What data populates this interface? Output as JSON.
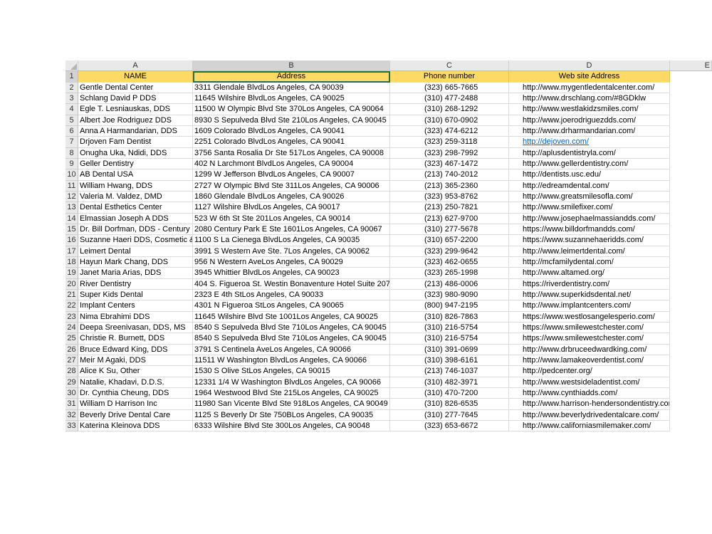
{
  "columns": [
    "A",
    "B",
    "C",
    "D",
    "E"
  ],
  "header_row": {
    "num": "1",
    "name": "NAME",
    "address": "Address",
    "phone": "Phone number",
    "website": "Web site Address"
  },
  "rows": [
    {
      "num": "2",
      "name": "Gentle Dental Center",
      "address": "3311 Glendale BlvdLos Angeles, CA 90039",
      "phone": "(323) 665-7665",
      "website": "http://www.mygentledentalcenter.com/"
    },
    {
      "num": "3",
      "name": "Schlang David P DDS",
      "address": "11645 Wilshire BlvdLos Angeles, CA 90025",
      "phone": "(310) 477-2488",
      "website": "http://www.drschlang.com/#8GDklw"
    },
    {
      "num": "4",
      "name": "Egle T. Lesniauskas, DDS",
      "address": "11500 W Olympic Blvd Ste 370Los Angeles, CA 90064",
      "phone": "(310) 268-1292",
      "website": "http://www.westlakidzsmiles.com/"
    },
    {
      "num": "5",
      "name": "Albert Joe Rodriguez DDS",
      "address": "8930 S Sepulveda Blvd Ste 210Los Angeles, CA 90045",
      "phone": "(310) 670-0902",
      "website": "http://www.joerodriguezdds.com/"
    },
    {
      "num": "6",
      "name": "Anna A Harmandarian, DDS",
      "address": "1609 Colorado BlvdLos Angeles, CA 90041",
      "phone": "(323) 474-6212",
      "website": "http://www.drharmandarian.com/"
    },
    {
      "num": "7",
      "name": "Drjoven Fam Dentist",
      "address": "2251 Colorado BlvdLos Angeles, CA 90041",
      "phone": "(323) 259-3118",
      "website": "http://dejoven.com/"
    },
    {
      "num": "8",
      "name": "Onugha Uka, Ndidi, DDS",
      "address": "3756 Santa Rosalia Dr Ste 517Los Angeles, CA 90008",
      "phone": "(323) 298-7992",
      "website": "http://aplusdentistryla.com/"
    },
    {
      "num": "9",
      "name": "Geller Dentistry",
      "address": "402 N Larchmont BlvdLos Angeles, CA 90004",
      "phone": "(323) 467-1472",
      "website": "http://www.gellerdentistry.com/"
    },
    {
      "num": "10",
      "name": "AB Dental USA",
      "address": "1299 W Jefferson BlvdLos Angeles, CA 90007",
      "phone": "(213) 740-2012",
      "website": "http://dentists.usc.edu/"
    },
    {
      "num": "11",
      "name": "William Hwang, DDS",
      "address": "2727 W Olympic Blvd Ste 311Los Angeles, CA 90006",
      "phone": "(213) 365-2360",
      "website": "http://edreamdental.com/"
    },
    {
      "num": "12",
      "name": "Valeria M. Valdez, DMD",
      "address": "1860 Glendale BlvdLos Angeles, CA 90026",
      "phone": "(323) 953-8762",
      "website": "http://www.greatsmilesofla.com/"
    },
    {
      "num": "13",
      "name": "Dental Esthetics Center",
      "address": "1127 Wilshire BlvdLos Angeles, CA 90017",
      "phone": "(213) 250-7821",
      "website": "http://www.smilefixer.com/"
    },
    {
      "num": "14",
      "name": "Elmassian Joseph A DDS",
      "address": "523 W 6th St Ste 201Los Angeles, CA 90014",
      "phone": "(213) 627-9700",
      "website": "http://www.josephaelmassiandds.com/"
    },
    {
      "num": "15",
      "name": "Dr. Bill Dorfman, DDS - Century C",
      "address": "2080 Century Park E Ste 1601Los Angeles, CA 90067",
      "phone": "(310) 277-5678",
      "website": "https://www.billdorfmandds.com/"
    },
    {
      "num": "16",
      "name": "Suzanne Haeri DDS, Cosmetic & C",
      "address": "1100 S La Cienega BlvdLos Angeles, CA 90035",
      "phone": "(310) 657-2200",
      "website": "https://www.suzannehaeridds.com/"
    },
    {
      "num": "17",
      "name": "Leimert Dental",
      "address": "3991 S Western Ave Ste. 7Los Angeles, CA 90062",
      "phone": "(323) 299-9642",
      "website": "http://www.leimertdental.com/"
    },
    {
      "num": "18",
      "name": "Hayun Mark Chang, DDS",
      "address": "956 N Western AveLos Angeles, CA 90029",
      "phone": "(323) 462-0655",
      "website": "http://mcfamilydental.com/"
    },
    {
      "num": "19",
      "name": "Janet Maria Arias, DDS",
      "address": "3945 Whittier BlvdLos Angeles, CA 90023",
      "phone": "(323) 265-1998",
      "website": "http://www.altamed.org/"
    },
    {
      "num": "20",
      "name": "River Dentistry",
      "address": "404 S. Figueroa St. Westin Bonaventure Hotel  Suite 207",
      "phone": "(213) 486-0006",
      "website": "https://riverdentistry.com/"
    },
    {
      "num": "21",
      "name": "Super Kids Dental",
      "address": "2323 E 4th StLos Angeles, CA 90033",
      "phone": "(323) 980-9090",
      "website": "http://www.superkidsdental.net/"
    },
    {
      "num": "22",
      "name": "Implant Centers",
      "address": "4301 N Figueroa StLos Angeles, CA 90065",
      "phone": "(800) 947-2195",
      "website": "http://www.implantcenters.com/"
    },
    {
      "num": "23",
      "name": "Nima Ebrahimi DDS",
      "address": "11645 Wilshire Blvd Ste 1001Los Angeles, CA 90025",
      "phone": "(310) 826-7863",
      "website": "https://www.westlosangelesperio.com/"
    },
    {
      "num": "24",
      "name": "Deepa Sreenivasan, DDS, MS",
      "address": "8540 S Sepulveda Blvd Ste 710Los Angeles, CA 90045",
      "phone": "(310) 216-5754",
      "website": "https://www.smilewestchester.com/"
    },
    {
      "num": "25",
      "name": "Christie R. Burnett, DDS",
      "address": "8540 S Sepulveda Blvd Ste 710Los Angeles, CA 90045",
      "phone": "(310) 216-5754",
      "website": "https://www.smilewestchester.com/"
    },
    {
      "num": "26",
      "name": "Bruce Edward King, DDS",
      "address": "3791 S Centinela AveLos Angeles, CA 90066",
      "phone": "(310) 391-0699",
      "website": "http://www.drbruceedwardking.com/"
    },
    {
      "num": "27",
      "name": "Meir M Agaki, DDS",
      "address": "11511 W Washington BlvdLos Angeles, CA 90066",
      "phone": "(310) 398-6161",
      "website": "http://www.lamakeoverdentist.com/"
    },
    {
      "num": "28",
      "name": "Alice K Su, Other",
      "address": "1530 S Olive StLos Angeles, CA 90015",
      "phone": "(213) 746-1037",
      "website": "http://pedcenter.org/"
    },
    {
      "num": "29",
      "name": "Natalie, Khadavi, D.D.S.",
      "address": "12331 1/4 W Washington BlvdLos Angeles, CA 90066",
      "phone": "(310) 482-3971",
      "website": "http://www.westsideladentist.com/"
    },
    {
      "num": "30",
      "name": "Dr. Cynthia Cheung, DDS",
      "address": "1964 Westwood Blvd Ste 215Los Angeles, CA 90025",
      "phone": "(310) 470-7200",
      "website": "http://www.cynthiadds.com/"
    },
    {
      "num": "31",
      "name": "William D Harrison Inc",
      "address": "11980 San Vicente Blvd Ste 918Los Angeles, CA 90049",
      "phone": "(310) 826-6535",
      "website": "http://www.harrison-hendersondentistry.com/"
    },
    {
      "num": "32",
      "name": "Beverly Drive Dental Care",
      "address": "1125 S Beverly Dr Ste 750BLos Angeles, CA 90035",
      "phone": "(310) 277-7645",
      "website": "http://www.beverlydrivedentalcare.com/"
    },
    {
      "num": "33",
      "name": "Katerina Kleinova DDS",
      "address": "6333 Wilshire Blvd Ste 300Los Angeles, CA 90048",
      "phone": "(323) 653-6672",
      "website": "http://www.californiasmilemaker.com/"
    }
  ],
  "colors": {
    "header_fill": "#ffd966",
    "selection": "#217346",
    "hyperlink": "#0563c1"
  }
}
